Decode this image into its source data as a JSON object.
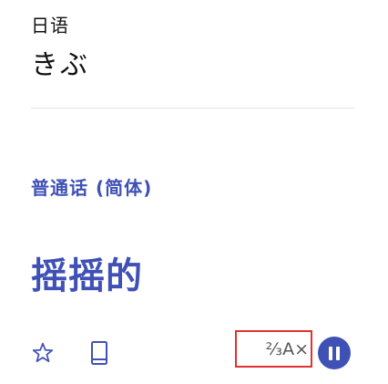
{
  "source": {
    "language": "日语",
    "text": "きぶ"
  },
  "target": {
    "language": "普通话 (简体)",
    "text": "摇摇的"
  },
  "font_size_button": {
    "label": "⅔A×"
  },
  "icons": {
    "star": "star-outline-icon",
    "copy": "copy-icon",
    "pause": "pause-icon"
  },
  "colors": {
    "accent": "#3f51b5",
    "highlight_border": "#e0322e",
    "text": "#111111"
  }
}
